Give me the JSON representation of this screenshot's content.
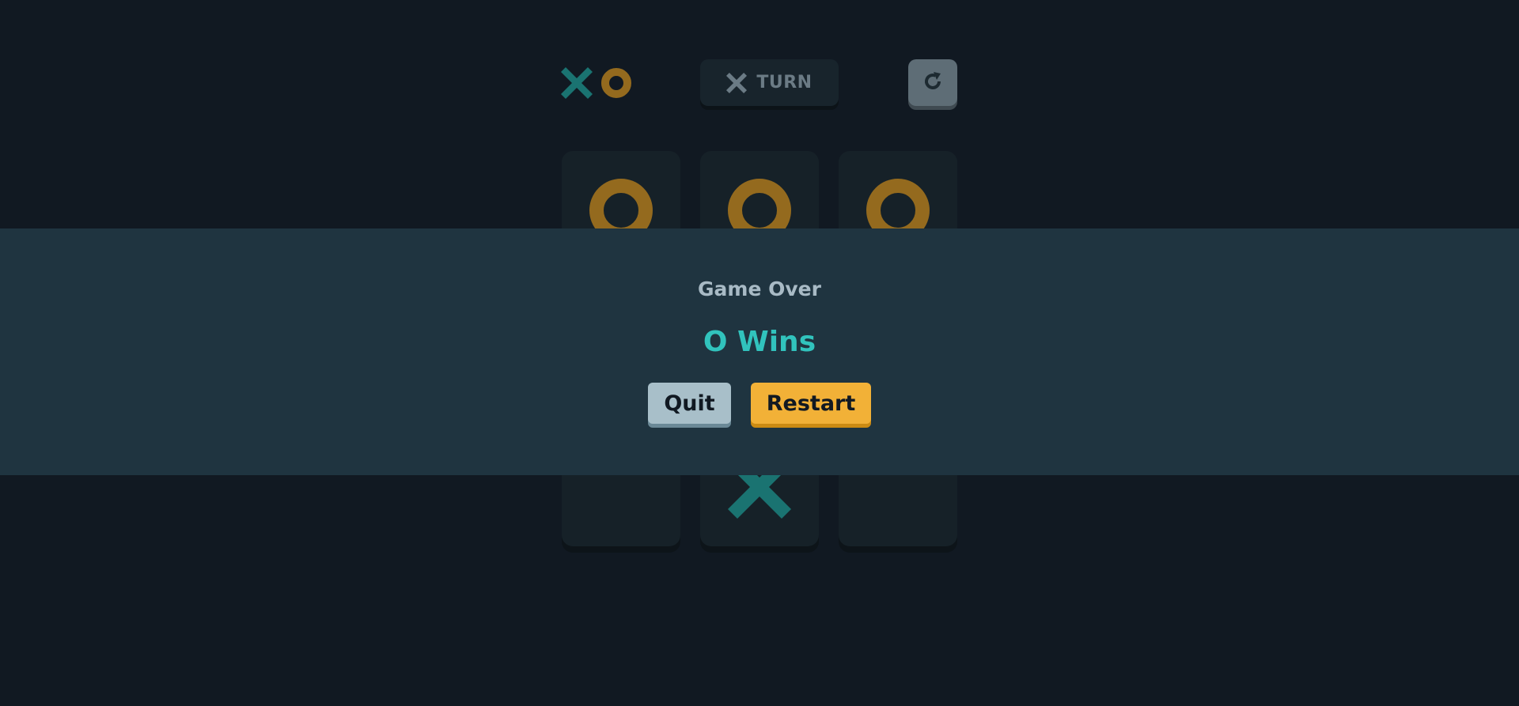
{
  "header": {
    "logo_icon": "xo-logo-icon",
    "turn": {
      "mark": "X",
      "mark_icon": "x-mark-icon",
      "label": "TURN"
    },
    "reset_icon": "restart-arrow-icon"
  },
  "board": {
    "cells": [
      "O",
      "O",
      "O",
      "",
      "",
      "",
      "",
      "X",
      ""
    ]
  },
  "overlay": {
    "title": "Game Over",
    "winner_text": "O Wins",
    "quit_label": "Quit",
    "restart_label": "Restart"
  },
  "colors": {
    "background": "#111922",
    "x_mark": "#1a7371",
    "o_mark": "#946a1e",
    "winner_text": "#31c3bd",
    "overlay_band": "#1f3440",
    "quit_button": "#a8bfc9",
    "restart_button": "#f2b137"
  }
}
